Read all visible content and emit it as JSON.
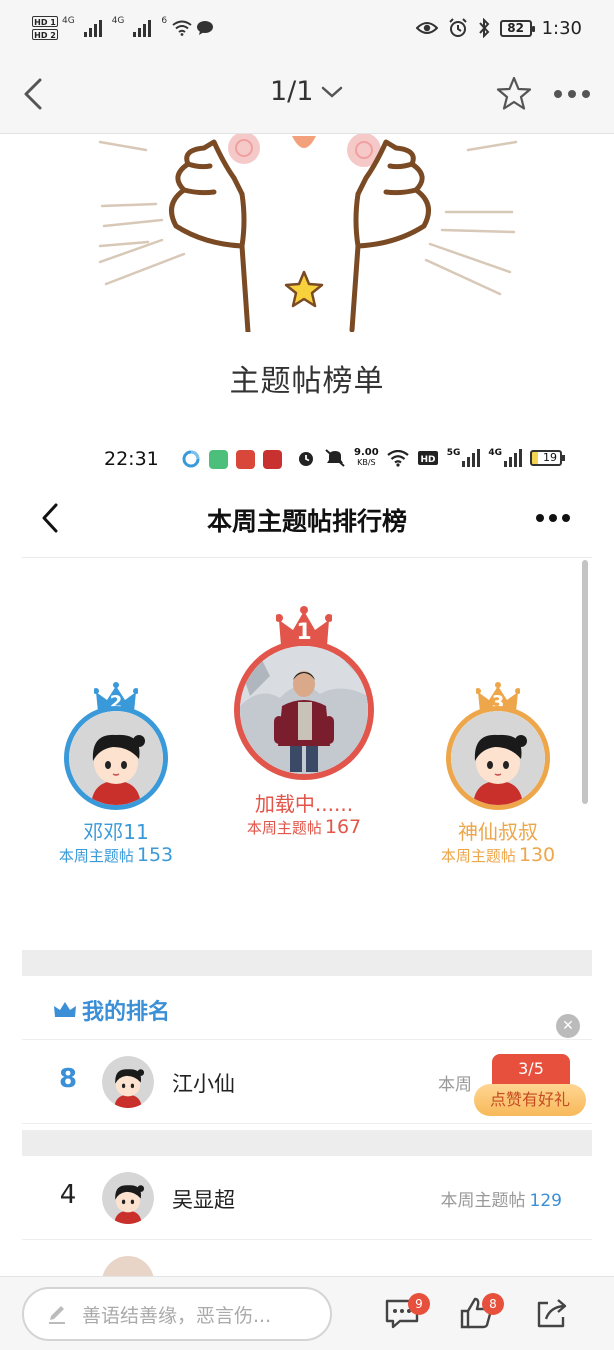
{
  "status_bar": {
    "hd1": "HD 1",
    "hd2": "HD 2",
    "net1": "4G",
    "net2": "4G",
    "net3": "6",
    "battery": "82",
    "time": "1:30"
  },
  "top_nav": {
    "pager": "1/1"
  },
  "post": {
    "title": "主题帖榜单"
  },
  "inner_status": {
    "time": "22:31",
    "speed_value": "9.00",
    "speed_unit": "KB/S",
    "net_a": "5G",
    "net_b": "4G",
    "battery": "19"
  },
  "ranking_page": {
    "title": "本周主题帖排行榜",
    "count_label": "本周主题帖",
    "podium": [
      {
        "rank": "2",
        "name": "邓邓11",
        "count": "153",
        "color": "#3a9ad9"
      },
      {
        "rank": "1",
        "name": "加载中......",
        "count": "167",
        "color": "#e2554a"
      },
      {
        "rank": "3",
        "name": "神仙叔叔",
        "count": "130",
        "color": "#eda64a"
      }
    ],
    "my_rank": {
      "heading": "我的排名",
      "rank": "8",
      "name": "江小仙",
      "count_label_partial": "本周"
    },
    "list": [
      {
        "rank": "4",
        "name": "吴显超",
        "count": "129"
      }
    ],
    "promo": {
      "progress": "3/5",
      "label": "点赞有好礼"
    }
  },
  "bottom_bar": {
    "comment_placeholder": "善语结善缘，恶言伤...",
    "comment_badge": "9",
    "like_badge": "8"
  },
  "colors": {
    "blue": "#3a9ad9",
    "red": "#e2554a",
    "orange": "#eda64a",
    "badge_red": "#e8503e"
  }
}
